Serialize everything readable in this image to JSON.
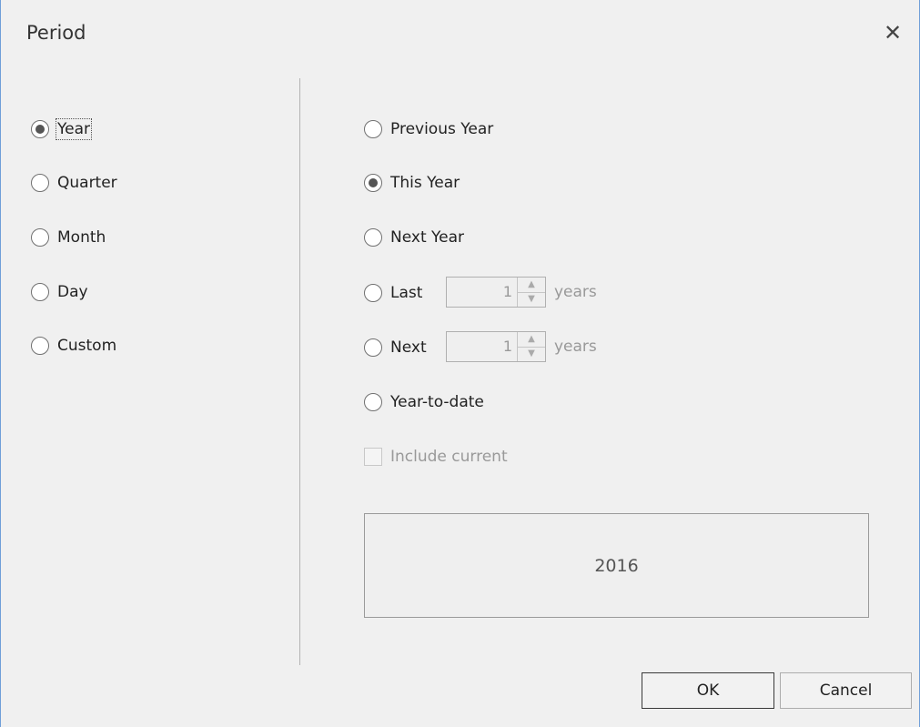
{
  "dialog": {
    "title": "Period",
    "close_glyph": "✕"
  },
  "period_types": [
    {
      "label": "Year",
      "checked": true
    },
    {
      "label": "Quarter",
      "checked": false
    },
    {
      "label": "Month",
      "checked": false
    },
    {
      "label": "Day",
      "checked": false
    },
    {
      "label": "Custom",
      "checked": false
    }
  ],
  "range_options": {
    "previous": "Previous Year",
    "this": "This Year",
    "next": "Next Year",
    "last": "Last",
    "next_n": "Next",
    "to_date": "Year-to-date",
    "selected": "This Year"
  },
  "last_spin": {
    "value": "1",
    "unit": "years"
  },
  "next_spin": {
    "value": "1",
    "unit": "years"
  },
  "include_current": {
    "label": "Include current",
    "checked": false,
    "enabled": false
  },
  "preview": {
    "text": "2016"
  },
  "buttons": {
    "ok": "OK",
    "cancel": "Cancel"
  },
  "colors": {
    "window_border": "#6f9fd8",
    "background": "#f0f0f0"
  }
}
